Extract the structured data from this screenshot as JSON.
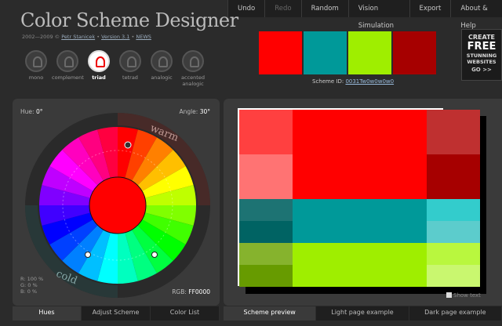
{
  "header": {
    "title": "Color Scheme Designer",
    "copyright": "2002—2009 © ",
    "author": "Petr Stanicek",
    "separator1": " • ",
    "version": "Version 3.1",
    "separator2": " • ",
    "news": "NEWS"
  },
  "menu": {
    "undo": "Undo",
    "redo": "Redo",
    "random": "Random",
    "vision": "Vision Simulation",
    "export": "Export",
    "about": "About & Help"
  },
  "modes": [
    {
      "label": "mono",
      "active": false
    },
    {
      "label": "complement",
      "active": false
    },
    {
      "label": "triad",
      "active": true
    },
    {
      "label": "tetrad",
      "active": false
    },
    {
      "label": "analogic",
      "active": false
    },
    {
      "label": "accented analogic",
      "active": false
    }
  ],
  "swatches": [
    "#FF0000",
    "#009999",
    "#9FEE00",
    "#A60000"
  ],
  "scheme": {
    "label": "Scheme ID: ",
    "id": "0031Tw0w0w0w0"
  },
  "ad": {
    "line1": "CREATE",
    "line2": "FREE",
    "line3": "STUNNING WEBSITES",
    "line4": "GO >>"
  },
  "wheel": {
    "hue_label": "Hue:",
    "hue_value": "0°",
    "angle_label": "Angle:",
    "angle_value": "30°",
    "warm": "warm",
    "cold": "cold",
    "r_label": "R: 100 %",
    "g_label": "G:     0 %",
    "b_label": "B:     0 %",
    "rgb_label": "RGB:",
    "rgb_value": "FF0000",
    "center_color": "#FF0000"
  },
  "left_tabs": [
    {
      "label": "Hues",
      "active": true
    },
    {
      "label": "Adjust Scheme",
      "active": false
    },
    {
      "label": "Color List",
      "active": false
    }
  ],
  "right_tabs": [
    {
      "label": "Scheme preview",
      "active": true
    },
    {
      "label": "Light page example",
      "active": false
    },
    {
      "label": "Dark page example",
      "active": false
    }
  ],
  "preview_colors": {
    "primary": [
      "#FF0000",
      "#FF4040",
      "#FF7373",
      "#BF3030",
      "#A60000"
    ],
    "secondary_a": [
      "#009999",
      "#1D7373",
      "#006363",
      "#33CCCC",
      "#5CCCCC"
    ],
    "secondary_b": [
      "#9FEE00",
      "#86B32D",
      "#679B00",
      "#B9F73E",
      "#C9F76F"
    ]
  },
  "show_text": "Show text"
}
